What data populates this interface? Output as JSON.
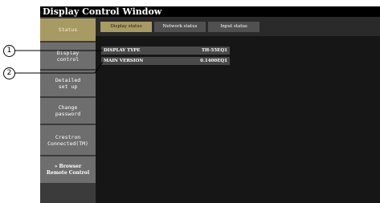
{
  "window": {
    "title": "Display Control Window"
  },
  "sidebar": {
    "items": [
      {
        "label": "Status"
      },
      {
        "label": "Display\ncontrol"
      },
      {
        "label": "Detailed\nset up"
      },
      {
        "label": "Change\npassword"
      },
      {
        "label": "Crestron\nConnected(TM)"
      },
      {
        "label": "» Browser\nRemote Control"
      }
    ]
  },
  "tabs": [
    {
      "label": "Display status"
    },
    {
      "label": "Network status"
    },
    {
      "label": "Input status"
    }
  ],
  "status": {
    "display_type_label": "DISPLAY TYPE",
    "display_type_value": "TH-55EQ1",
    "main_version_label": "MAIN VERSION",
    "main_version_value": "0.1400EQ1"
  },
  "callouts": {
    "one": "1",
    "two": "2"
  },
  "colors": {
    "accent": "#a89a63",
    "sidebar_item": "#6e6e6e",
    "background": "#161616"
  }
}
